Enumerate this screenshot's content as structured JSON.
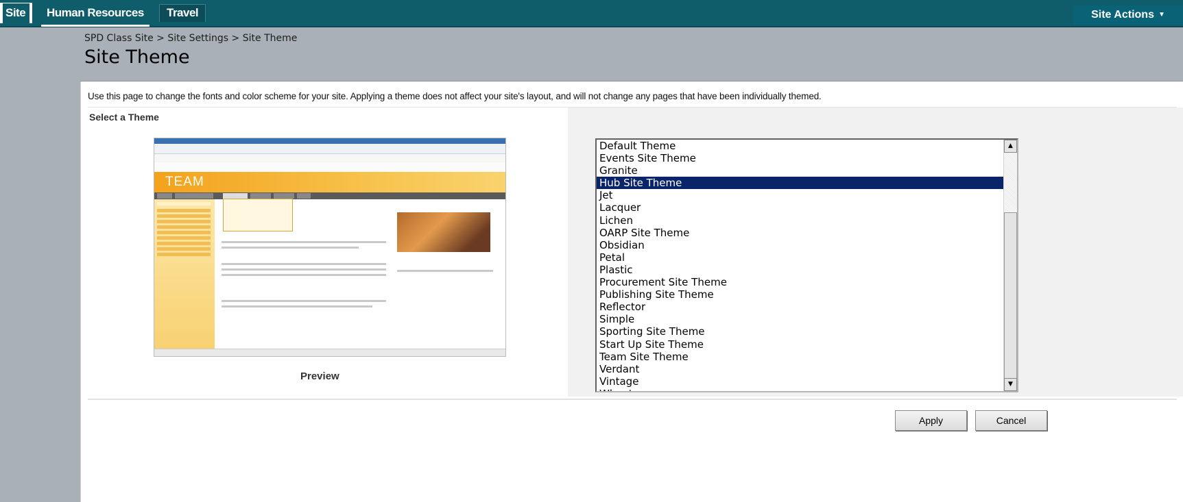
{
  "nav": {
    "tabs": [
      "Site",
      "Human Resources",
      "Travel"
    ],
    "site_actions": "Site Actions"
  },
  "header": {
    "breadcrumb": "SPD Class Site > Site Settings > Site Theme",
    "title": "Site Theme"
  },
  "main": {
    "description": "Use this page to change the fonts and color scheme for your site. Applying a theme does not affect your site's layout, and will not change any pages that have been individually themed.",
    "section_title": "Select a Theme",
    "preview_label": "Preview",
    "preview_image_text": "TEAM",
    "themes": [
      "Default Theme",
      "Events Site Theme",
      "Granite",
      "Hub Site Theme",
      "Jet",
      "Lacquer",
      "Lichen",
      "OARP Site Theme",
      "Obsidian",
      "Petal",
      "Plastic",
      "Procurement Site Theme",
      "Publishing Site Theme",
      "Reflector",
      "Simple",
      "Sporting Site Theme",
      "Start Up Site Theme",
      "Team Site Theme",
      "Verdant",
      "Vintage",
      "Wheat"
    ],
    "selected_theme": "Hub Site Theme"
  },
  "buttons": {
    "apply": "Apply",
    "cancel": "Cancel"
  },
  "colors": {
    "topnav": "#0f5c6b",
    "header_band": "#a9b0b7",
    "selection": "#0a246a"
  }
}
